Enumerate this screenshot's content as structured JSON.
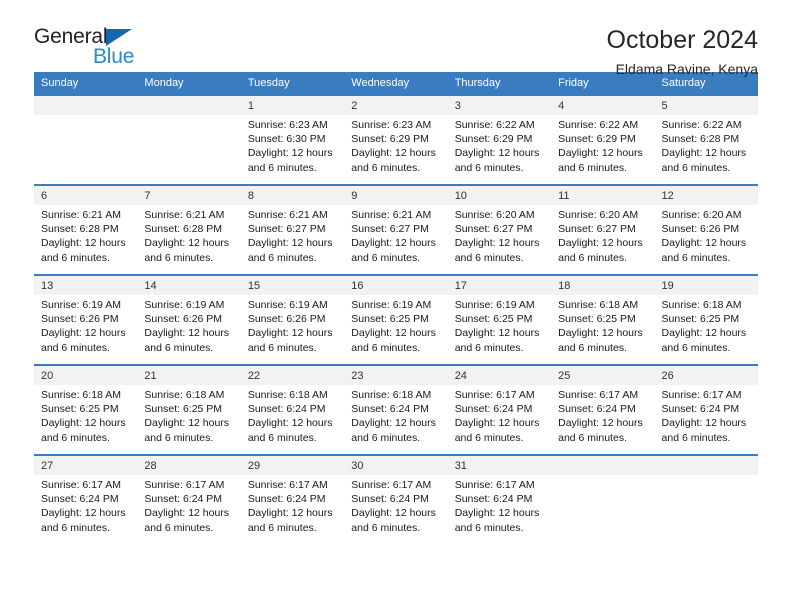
{
  "brand": {
    "name_top": "General",
    "name_bottom": "Blue",
    "triangle_icon": "triangle-icon",
    "color_dark": "#231f20",
    "color_blue": "#2b8ad1"
  },
  "header": {
    "title": "October 2024",
    "subtitle": "Eldama Ravine, Kenya"
  },
  "theme": {
    "header_bg": "#3a7cc0",
    "header_text": "#ffffff",
    "daynum_bg": "#f2f2f2",
    "cell_bg": "#ffffff"
  },
  "calendar": {
    "weekdays": [
      "Sunday",
      "Monday",
      "Tuesday",
      "Wednesday",
      "Thursday",
      "Friday",
      "Saturday"
    ],
    "weeks": [
      [
        {
          "day": "",
          "sunrise": "",
          "sunset": "",
          "daylight_line1": "",
          "daylight_line2": ""
        },
        {
          "day": "",
          "sunrise": "",
          "sunset": "",
          "daylight_line1": "",
          "daylight_line2": ""
        },
        {
          "day": "1",
          "sunrise": "Sunrise: 6:23 AM",
          "sunset": "Sunset: 6:30 PM",
          "daylight_line1": "Daylight: 12 hours",
          "daylight_line2": "and 6 minutes."
        },
        {
          "day": "2",
          "sunrise": "Sunrise: 6:23 AM",
          "sunset": "Sunset: 6:29 PM",
          "daylight_line1": "Daylight: 12 hours",
          "daylight_line2": "and 6 minutes."
        },
        {
          "day": "3",
          "sunrise": "Sunrise: 6:22 AM",
          "sunset": "Sunset: 6:29 PM",
          "daylight_line1": "Daylight: 12 hours",
          "daylight_line2": "and 6 minutes."
        },
        {
          "day": "4",
          "sunrise": "Sunrise: 6:22 AM",
          "sunset": "Sunset: 6:29 PM",
          "daylight_line1": "Daylight: 12 hours",
          "daylight_line2": "and 6 minutes."
        },
        {
          "day": "5",
          "sunrise": "Sunrise: 6:22 AM",
          "sunset": "Sunset: 6:28 PM",
          "daylight_line1": "Daylight: 12 hours",
          "daylight_line2": "and 6 minutes."
        }
      ],
      [
        {
          "day": "6",
          "sunrise": "Sunrise: 6:21 AM",
          "sunset": "Sunset: 6:28 PM",
          "daylight_line1": "Daylight: 12 hours",
          "daylight_line2": "and 6 minutes."
        },
        {
          "day": "7",
          "sunrise": "Sunrise: 6:21 AM",
          "sunset": "Sunset: 6:28 PM",
          "daylight_line1": "Daylight: 12 hours",
          "daylight_line2": "and 6 minutes."
        },
        {
          "day": "8",
          "sunrise": "Sunrise: 6:21 AM",
          "sunset": "Sunset: 6:27 PM",
          "daylight_line1": "Daylight: 12 hours",
          "daylight_line2": "and 6 minutes."
        },
        {
          "day": "9",
          "sunrise": "Sunrise: 6:21 AM",
          "sunset": "Sunset: 6:27 PM",
          "daylight_line1": "Daylight: 12 hours",
          "daylight_line2": "and 6 minutes."
        },
        {
          "day": "10",
          "sunrise": "Sunrise: 6:20 AM",
          "sunset": "Sunset: 6:27 PM",
          "daylight_line1": "Daylight: 12 hours",
          "daylight_line2": "and 6 minutes."
        },
        {
          "day": "11",
          "sunrise": "Sunrise: 6:20 AM",
          "sunset": "Sunset: 6:27 PM",
          "daylight_line1": "Daylight: 12 hours",
          "daylight_line2": "and 6 minutes."
        },
        {
          "day": "12",
          "sunrise": "Sunrise: 6:20 AM",
          "sunset": "Sunset: 6:26 PM",
          "daylight_line1": "Daylight: 12 hours",
          "daylight_line2": "and 6 minutes."
        }
      ],
      [
        {
          "day": "13",
          "sunrise": "Sunrise: 6:19 AM",
          "sunset": "Sunset: 6:26 PM",
          "daylight_line1": "Daylight: 12 hours",
          "daylight_line2": "and 6 minutes."
        },
        {
          "day": "14",
          "sunrise": "Sunrise: 6:19 AM",
          "sunset": "Sunset: 6:26 PM",
          "daylight_line1": "Daylight: 12 hours",
          "daylight_line2": "and 6 minutes."
        },
        {
          "day": "15",
          "sunrise": "Sunrise: 6:19 AM",
          "sunset": "Sunset: 6:26 PM",
          "daylight_line1": "Daylight: 12 hours",
          "daylight_line2": "and 6 minutes."
        },
        {
          "day": "16",
          "sunrise": "Sunrise: 6:19 AM",
          "sunset": "Sunset: 6:25 PM",
          "daylight_line1": "Daylight: 12 hours",
          "daylight_line2": "and 6 minutes."
        },
        {
          "day": "17",
          "sunrise": "Sunrise: 6:19 AM",
          "sunset": "Sunset: 6:25 PM",
          "daylight_line1": "Daylight: 12 hours",
          "daylight_line2": "and 6 minutes."
        },
        {
          "day": "18",
          "sunrise": "Sunrise: 6:18 AM",
          "sunset": "Sunset: 6:25 PM",
          "daylight_line1": "Daylight: 12 hours",
          "daylight_line2": "and 6 minutes."
        },
        {
          "day": "19",
          "sunrise": "Sunrise: 6:18 AM",
          "sunset": "Sunset: 6:25 PM",
          "daylight_line1": "Daylight: 12 hours",
          "daylight_line2": "and 6 minutes."
        }
      ],
      [
        {
          "day": "20",
          "sunrise": "Sunrise: 6:18 AM",
          "sunset": "Sunset: 6:25 PM",
          "daylight_line1": "Daylight: 12 hours",
          "daylight_line2": "and 6 minutes."
        },
        {
          "day": "21",
          "sunrise": "Sunrise: 6:18 AM",
          "sunset": "Sunset: 6:25 PM",
          "daylight_line1": "Daylight: 12 hours",
          "daylight_line2": "and 6 minutes."
        },
        {
          "day": "22",
          "sunrise": "Sunrise: 6:18 AM",
          "sunset": "Sunset: 6:24 PM",
          "daylight_line1": "Daylight: 12 hours",
          "daylight_line2": "and 6 minutes."
        },
        {
          "day": "23",
          "sunrise": "Sunrise: 6:18 AM",
          "sunset": "Sunset: 6:24 PM",
          "daylight_line1": "Daylight: 12 hours",
          "daylight_line2": "and 6 minutes."
        },
        {
          "day": "24",
          "sunrise": "Sunrise: 6:17 AM",
          "sunset": "Sunset: 6:24 PM",
          "daylight_line1": "Daylight: 12 hours",
          "daylight_line2": "and 6 minutes."
        },
        {
          "day": "25",
          "sunrise": "Sunrise: 6:17 AM",
          "sunset": "Sunset: 6:24 PM",
          "daylight_line1": "Daylight: 12 hours",
          "daylight_line2": "and 6 minutes."
        },
        {
          "day": "26",
          "sunrise": "Sunrise: 6:17 AM",
          "sunset": "Sunset: 6:24 PM",
          "daylight_line1": "Daylight: 12 hours",
          "daylight_line2": "and 6 minutes."
        }
      ],
      [
        {
          "day": "27",
          "sunrise": "Sunrise: 6:17 AM",
          "sunset": "Sunset: 6:24 PM",
          "daylight_line1": "Daylight: 12 hours",
          "daylight_line2": "and 6 minutes."
        },
        {
          "day": "28",
          "sunrise": "Sunrise: 6:17 AM",
          "sunset": "Sunset: 6:24 PM",
          "daylight_line1": "Daylight: 12 hours",
          "daylight_line2": "and 6 minutes."
        },
        {
          "day": "29",
          "sunrise": "Sunrise: 6:17 AM",
          "sunset": "Sunset: 6:24 PM",
          "daylight_line1": "Daylight: 12 hours",
          "daylight_line2": "and 6 minutes."
        },
        {
          "day": "30",
          "sunrise": "Sunrise: 6:17 AM",
          "sunset": "Sunset: 6:24 PM",
          "daylight_line1": "Daylight: 12 hours",
          "daylight_line2": "and 6 minutes."
        },
        {
          "day": "31",
          "sunrise": "Sunrise: 6:17 AM",
          "sunset": "Sunset: 6:24 PM",
          "daylight_line1": "Daylight: 12 hours",
          "daylight_line2": "and 6 minutes."
        },
        {
          "day": "",
          "sunrise": "",
          "sunset": "",
          "daylight_line1": "",
          "daylight_line2": ""
        },
        {
          "day": "",
          "sunrise": "",
          "sunset": "",
          "daylight_line1": "",
          "daylight_line2": ""
        }
      ]
    ]
  }
}
